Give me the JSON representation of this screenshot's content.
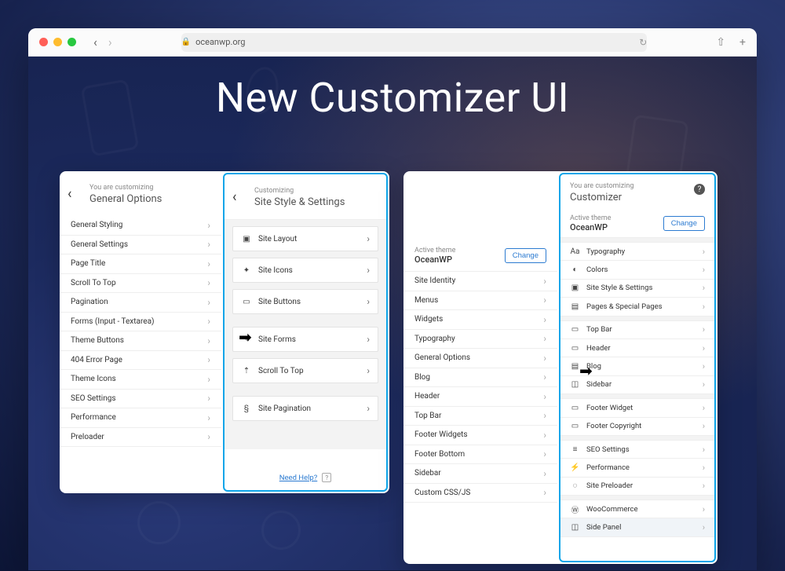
{
  "browser": {
    "url": "oceanwp.org"
  },
  "hero": "New Customizer UI",
  "old_general": {
    "sup": "You are customizing",
    "title": "General Options",
    "items": [
      "General Styling",
      "General Settings",
      "Page Title",
      "Scroll To Top",
      "Pagination",
      "Forms (Input - Textarea)",
      "Theme Buttons",
      "404 Error Page",
      "Theme Icons",
      "SEO Settings",
      "Performance",
      "Preloader"
    ]
  },
  "new_style": {
    "sup": "Customizing",
    "title": "Site Style & Settings",
    "items": [
      {
        "icon": "▣",
        "label": "Site Layout"
      },
      {
        "icon": "✦",
        "label": "Site Icons"
      },
      {
        "icon": "▭",
        "label": "Site Buttons"
      },
      {
        "icon": "✎",
        "label": "Site Forms"
      },
      {
        "icon": "⇡",
        "label": "Scroll To Top"
      },
      {
        "icon": "§",
        "label": "Site Pagination"
      }
    ],
    "help": "Need Help?"
  },
  "old_root": {
    "theme_label": "Active theme",
    "theme_name": "OceanWP",
    "change": "Change",
    "items": [
      "Site Identity",
      "Menus",
      "Widgets",
      "Typography",
      "General Options",
      "Blog",
      "Header",
      "Top Bar",
      "Footer Widgets",
      "Footer Bottom",
      "Sidebar",
      "Custom CSS/JS"
    ]
  },
  "new_root": {
    "sup": "You are customizing",
    "title": "Customizer",
    "theme_label": "Active theme",
    "theme_name": "OceanWP",
    "change": "Change",
    "items": [
      {
        "icon": "Aa",
        "label": "Typography"
      },
      {
        "icon": "◐",
        "label": "Colors"
      },
      {
        "icon": "▣",
        "label": "Site Style & Settings"
      },
      {
        "icon": "▤",
        "label": "Pages & Special Pages"
      },
      {
        "icon": "▭",
        "label": "Top Bar",
        "gap": true
      },
      {
        "icon": "▭",
        "label": "Header"
      },
      {
        "icon": "▤",
        "label": "Blog"
      },
      {
        "icon": "◫",
        "label": "Sidebar"
      },
      {
        "icon": "▭",
        "label": "Footer Widget",
        "gap": true
      },
      {
        "icon": "▭",
        "label": "Footer Copyright"
      },
      {
        "icon": "≡",
        "label": "SEO Settings",
        "gap": true
      },
      {
        "icon": "⚡",
        "label": "Performance"
      },
      {
        "icon": "◌",
        "label": "Site Preloader"
      },
      {
        "icon": "Ⓦ",
        "label": "WooCommerce",
        "gap": true
      },
      {
        "icon": "◫",
        "label": "Side Panel",
        "active": true
      }
    ]
  }
}
